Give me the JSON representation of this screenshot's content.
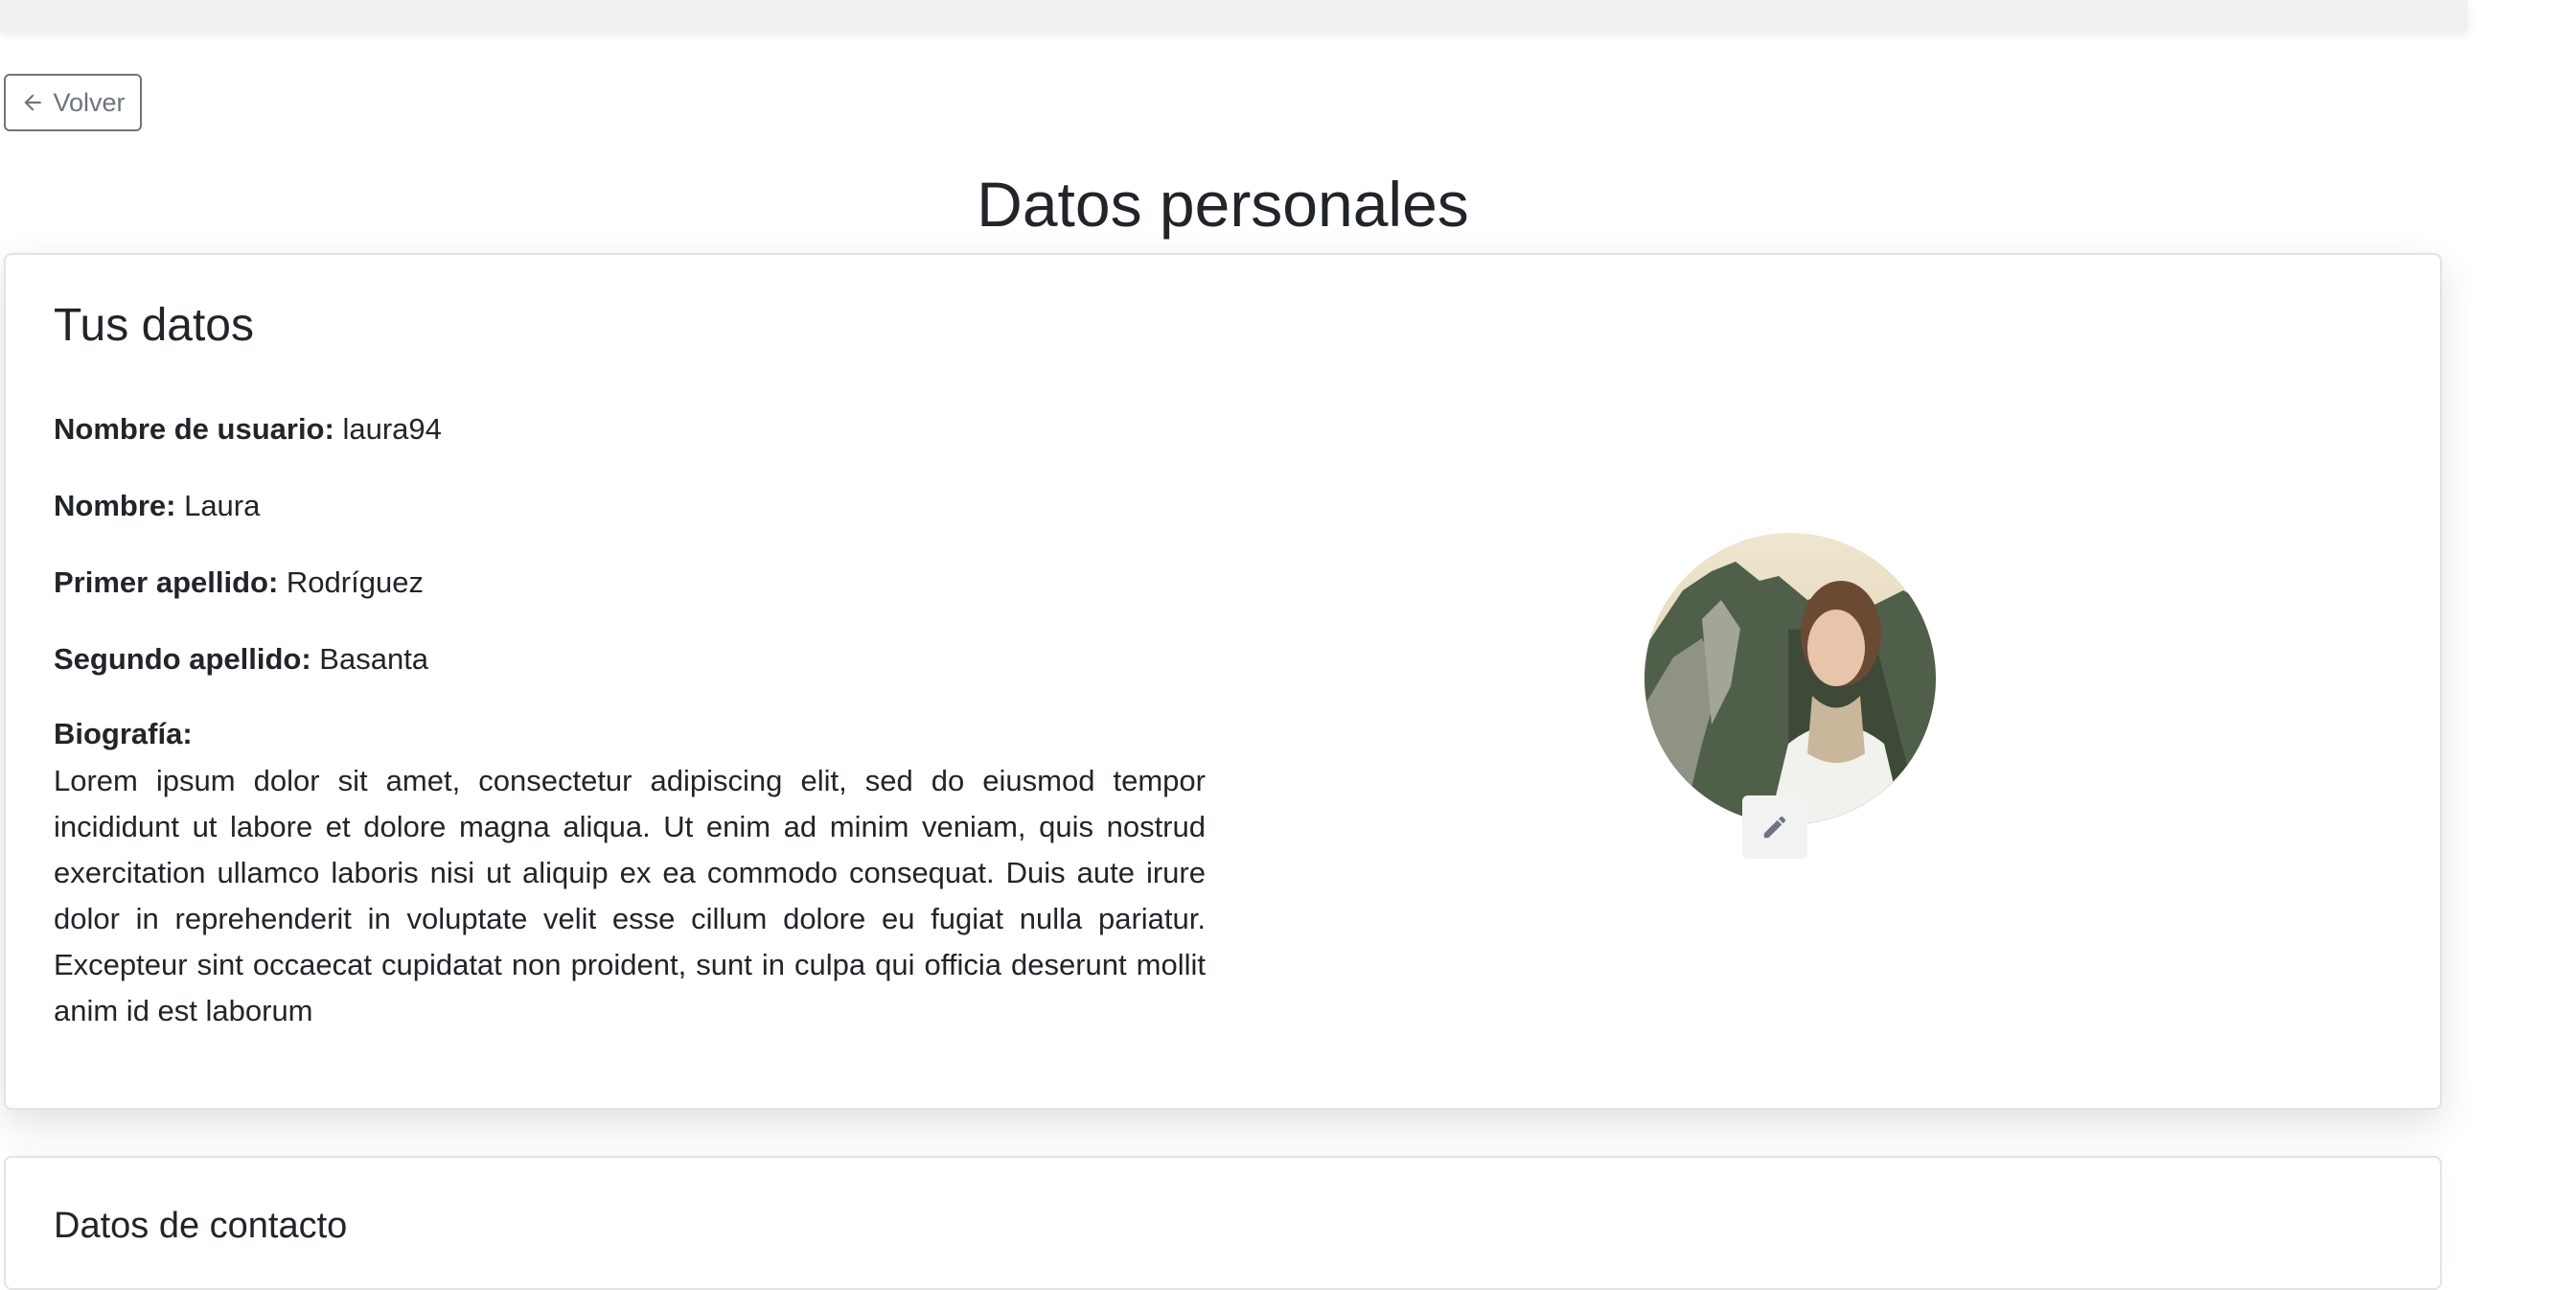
{
  "nav": {
    "back_label": "Volver"
  },
  "page": {
    "title": "Datos personales"
  },
  "profile_card": {
    "title": "Tus datos",
    "fields": [
      {
        "label": "Nombre de usuario:",
        "value": "laura94"
      },
      {
        "label": "Nombre:",
        "value": "Laura"
      },
      {
        "label": "Primer apellido:",
        "value": "Rodríguez"
      },
      {
        "label": "Segundo apellido:",
        "value": "Basanta"
      }
    ],
    "bio_label": "Biografía:",
    "bio_text": "Lorem ipsum dolor sit amet, consectetur adipiscing elit, sed do eiusmod tempor incididunt ut labore et dolore magna aliqua. Ut enim ad minim veniam, quis nostrud exercitation ullamco laboris nisi ut aliquip ex ea commodo consequat. Duis aute irure dolor in reprehenderit in voluptate velit esse cillum dolore eu fugiat nulla pariatur. Excepteur sint occaecat cupidatat non proident, sunt in culpa qui officia deserunt mollit anim id est laborum",
    "edit_icon": "pencil-icon"
  },
  "contact_card": {
    "title": "Datos de contacto"
  },
  "colors": {
    "text": "#212529",
    "secondary": "#6c757d",
    "topbar": "#f1f1f1"
  }
}
